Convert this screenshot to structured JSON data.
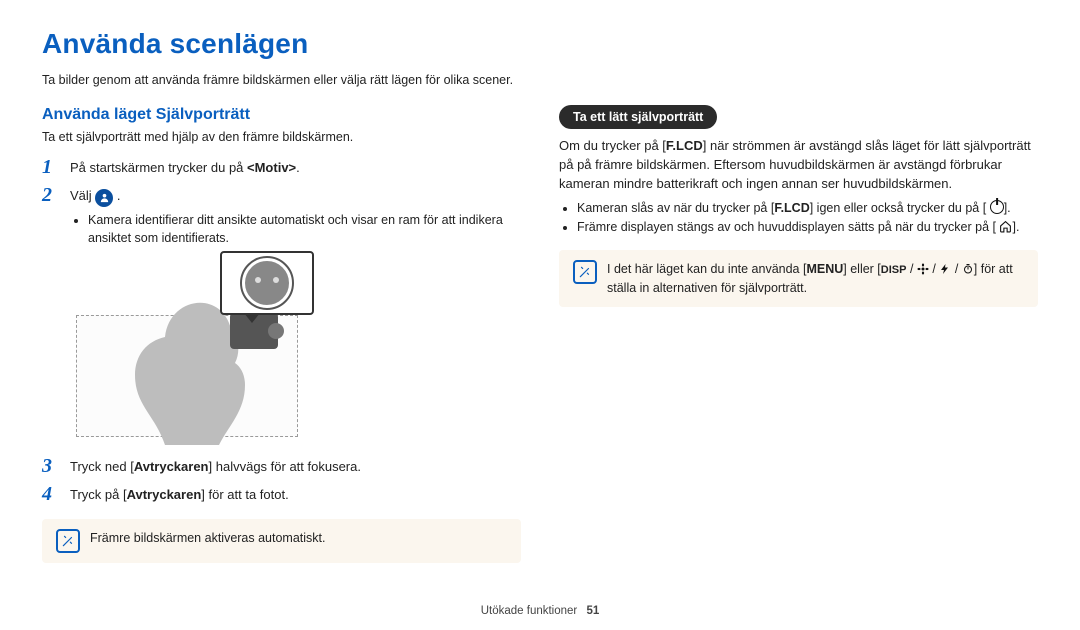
{
  "page": {
    "title": "Använda scenlägen",
    "lead": "Ta bilder genom att använda främre bildskärmen eller välja rätt lägen för olika scener.",
    "footer_section": "Utökade funktioner",
    "footer_page": "51"
  },
  "left": {
    "heading": "Använda läget Självporträtt",
    "subheading": "Ta ett självporträtt med hjälp av den främre bildskärmen.",
    "step1_pre": "På startskärmen trycker du på ",
    "step1_bold": "<Motiv>",
    "step1_post": ".",
    "step2_pre": "Välj ",
    "step2_post": " .",
    "step2_bullet": "Kamera identifierar ditt ansikte automatiskt och visar en ram för att indikera ansiktet som identifierats.",
    "step3_pre": "Tryck ned [",
    "step3_bold": "Avtryckaren",
    "step3_post": "] halvvägs för att fokusera.",
    "step4_pre": "Tryck på [",
    "step4_bold": "Avtryckaren",
    "step4_post": "] för att ta fotot.",
    "note": "Främre bildskärmen aktiveras automatiskt."
  },
  "right": {
    "pill": "Ta ett lätt självporträtt",
    "p1a": "Om du trycker på [",
    "p1_key": "F.LCD",
    "p1b": "] när strömmen är avstängd slås läget för lätt självporträtt på på främre bildskärmen. Eftersom huvudbildskärmen är avstängd förbrukar kameran mindre batterikraft och ingen annan ser huvudbildskärmen.",
    "b1a": "Kameran slås av när du trycker på [",
    "b1_key": "F.LCD",
    "b1b": "] igen eller också trycker du på [",
    "b1c": "].",
    "b2a": "Främre displayen stängs av och huvuddisplayen sätts på när du trycker på [",
    "b2b": "].",
    "note_a": "I det här läget kan du inte använda [",
    "note_menu": "MENU",
    "note_b": "] eller [",
    "note_disp": "DISP",
    "note_c": "] för att ställa in alternativen för självporträtt."
  },
  "numbers": {
    "n1": "1",
    "n2": "2",
    "n3": "3",
    "n4": "4"
  }
}
